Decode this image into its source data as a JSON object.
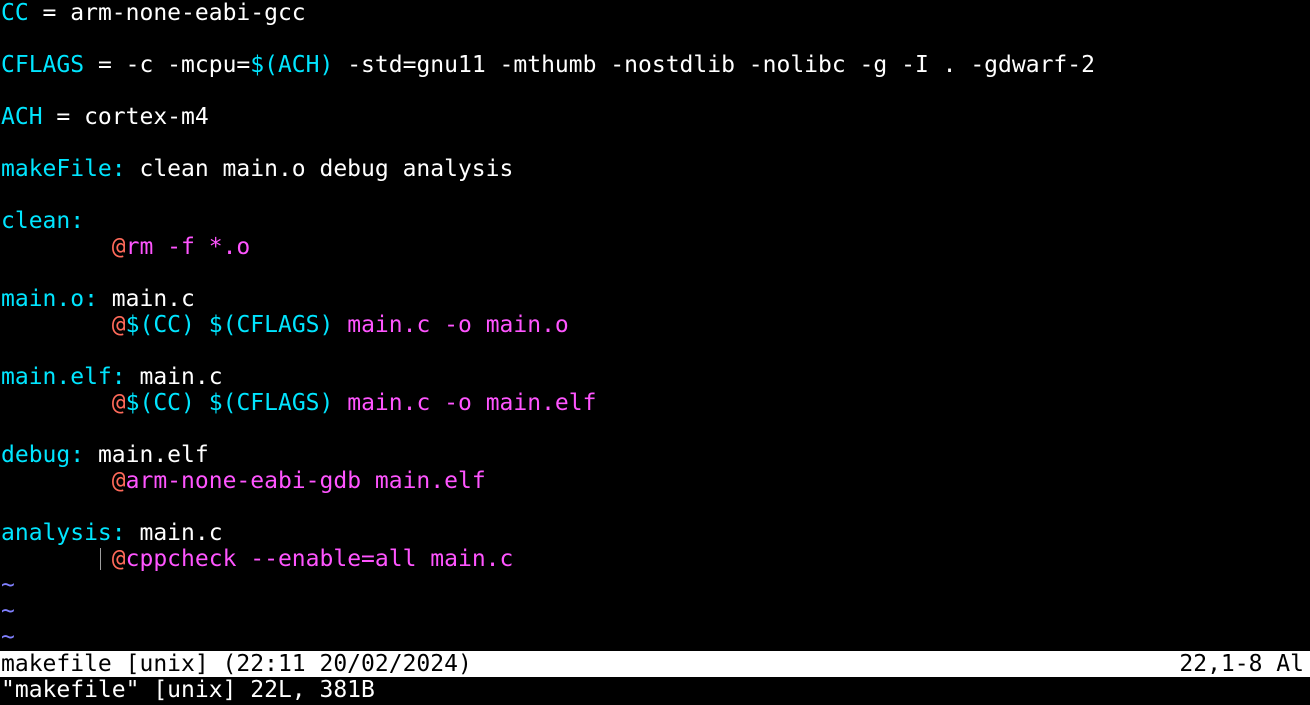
{
  "colors": {
    "background": "#000000",
    "variable": "#00e5ff",
    "target": "#00e5ff",
    "plain": "#ffffff",
    "command": "#ff55ff",
    "at_sign": "#ff6a5a",
    "tilde": "#8080ff",
    "status_bg": "#ffffff",
    "status_fg": "#000000"
  },
  "lines": [
    [
      {
        "t": "CC",
        "c": "variable"
      },
      {
        "t": " = arm-none-eabi-gcc",
        "c": "plain"
      }
    ],
    [],
    [
      {
        "t": "CFLAGS",
        "c": "variable"
      },
      {
        "t": " = -c -mcpu=",
        "c": "plain"
      },
      {
        "t": "$(ACH)",
        "c": "variable"
      },
      {
        "t": " -std=gnu11 -mthumb -nostdlib -nolibc -g -I . -gdwarf-2",
        "c": "plain"
      }
    ],
    [],
    [
      {
        "t": "ACH",
        "c": "variable"
      },
      {
        "t": " = cortex-m4",
        "c": "plain"
      }
    ],
    [],
    [
      {
        "t": "makeFile:",
        "c": "target"
      },
      {
        "t": " clean main.o debug analysis",
        "c": "plain"
      }
    ],
    [],
    [
      {
        "t": "clean:",
        "c": "target"
      }
    ],
    [
      {
        "t": "        ",
        "c": "plain"
      },
      {
        "t": "@",
        "c": "at_sign"
      },
      {
        "t": "rm -f *.o",
        "c": "command"
      }
    ],
    [],
    [
      {
        "t": "main.o:",
        "c": "target"
      },
      {
        "t": " main.c",
        "c": "plain"
      }
    ],
    [
      {
        "t": "        ",
        "c": "plain"
      },
      {
        "t": "@",
        "c": "at_sign"
      },
      {
        "t": "$(CC)",
        "c": "variable"
      },
      {
        "t": " ",
        "c": "plain"
      },
      {
        "t": "$(CFLAGS)",
        "c": "variable"
      },
      {
        "t": " main.c -o main.o",
        "c": "command"
      }
    ],
    [],
    [
      {
        "t": "main.elf:",
        "c": "target"
      },
      {
        "t": " main.c",
        "c": "plain"
      }
    ],
    [
      {
        "t": "        ",
        "c": "plain"
      },
      {
        "t": "@",
        "c": "at_sign"
      },
      {
        "t": "$(CC)",
        "c": "variable"
      },
      {
        "t": " ",
        "c": "plain"
      },
      {
        "t": "$(CFLAGS)",
        "c": "variable"
      },
      {
        "t": " main.c -o main.elf",
        "c": "command"
      }
    ],
    [],
    [
      {
        "t": "debug:",
        "c": "target"
      },
      {
        "t": " main.elf",
        "c": "plain"
      }
    ],
    [
      {
        "t": "        ",
        "c": "plain"
      },
      {
        "t": "@",
        "c": "at_sign"
      },
      {
        "t": "arm-none-eabi-gdb main.elf",
        "c": "command"
      }
    ],
    [],
    [
      {
        "t": "analysis:",
        "c": "target"
      },
      {
        "t": " main.c",
        "c": "plain"
      }
    ],
    [
      {
        "t": "        ",
        "c": "plain",
        "guide": true
      },
      {
        "t": "@",
        "c": "at_sign"
      },
      {
        "t": "cppcheck --enable=all main.c",
        "c": "command"
      }
    ]
  ],
  "tilde_lines": [
    "~",
    "~",
    "~"
  ],
  "status": {
    "left": "makefile [unix] (22:11 20/02/2024)",
    "right": "22,1-8 Al"
  },
  "message": "\"makefile\" [unix] 22L, 381B"
}
